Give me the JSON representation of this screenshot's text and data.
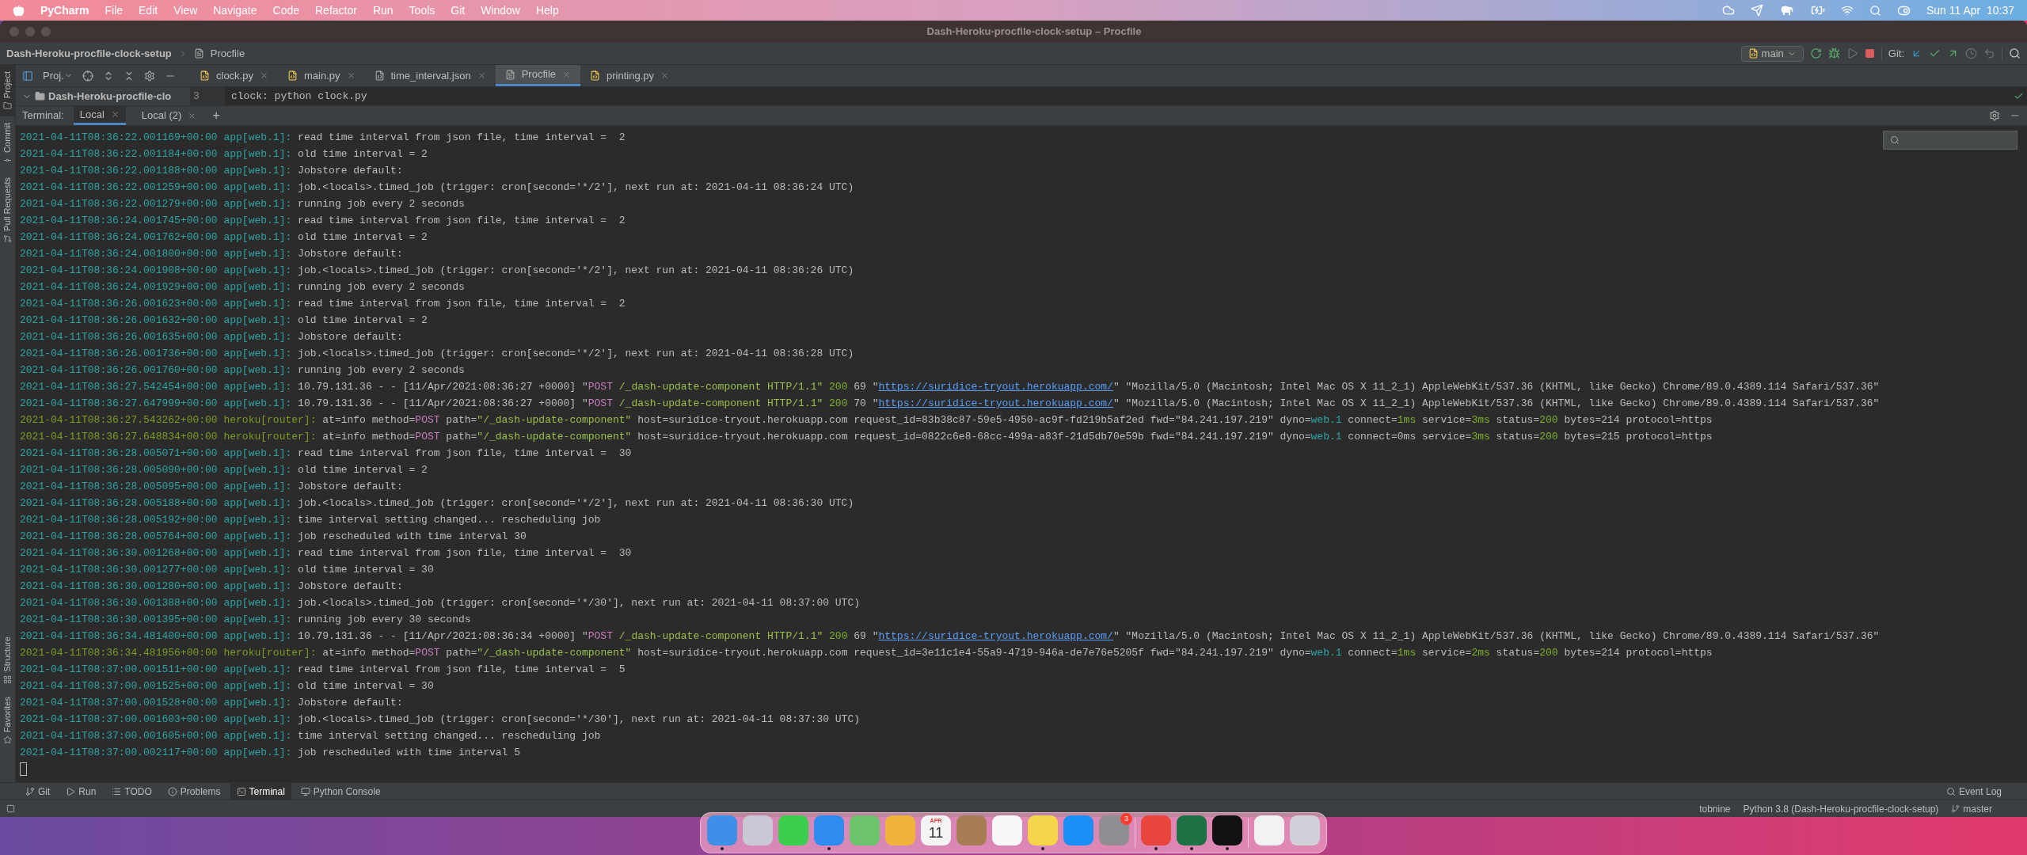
{
  "menu_bar": {
    "items": [
      "PyCharm",
      "File",
      "Edit",
      "View",
      "Navigate",
      "Code",
      "Refactor",
      "Run",
      "Tools",
      "Git",
      "Window",
      "Help"
    ],
    "clock": "Sun 11 Apr  10:37"
  },
  "window": {
    "title": "Dash-Heroku-procfile-clock-setup – Procfile"
  },
  "breadcrumb": [
    "Dash-Heroku-procfile-clock-setup",
    "Procfile"
  ],
  "toolbar": {
    "run_config": "main",
    "git_label": "Git:"
  },
  "project_panel": {
    "label": "Proj.",
    "root": "Dash-Heroku-procfile-clo"
  },
  "editor_tabs": [
    {
      "label": "clock.py",
      "kind": "python",
      "selected": false
    },
    {
      "label": "main.py",
      "kind": "python",
      "selected": false
    },
    {
      "label": "time_interval.json",
      "kind": "json",
      "selected": false
    },
    {
      "label": "Procfile",
      "kind": "text",
      "selected": true
    },
    {
      "label": "printing.py",
      "kind": "python",
      "selected": false
    }
  ],
  "editor": {
    "line_number": "3",
    "code": "clock: python clock.py"
  },
  "side_tabs": {
    "top": [
      {
        "label": "Project",
        "selected": true
      },
      {
        "label": "Commit",
        "selected": false
      },
      {
        "label": "Pull Requests",
        "selected": false
      }
    ],
    "bottom": [
      {
        "label": "Structure",
        "selected": false
      },
      {
        "label": "Favorites",
        "selected": false
      }
    ]
  },
  "terminal": {
    "label": "Terminal:",
    "tabs": [
      {
        "label": "Local",
        "selected": true
      },
      {
        "label": "Local (2)",
        "selected": false
      }
    ],
    "add": "+",
    "lines": [
      {
        "kind": "app",
        "timestamp": "2021-04-11T08:36:22.001169+00:00",
        "source": "app[web.1]:",
        "segments": [
          {
            "kind": "plain",
            "text": "read time interval from json file, time interval =  2"
          }
        ]
      },
      {
        "kind": "app",
        "timestamp": "2021-04-11T08:36:22.001184+00:00",
        "source": "app[web.1]:",
        "segments": [
          {
            "kind": "plain",
            "text": "old time interval = 2"
          }
        ]
      },
      {
        "kind": "app",
        "timestamp": "2021-04-11T08:36:22.001188+00:00",
        "source": "app[web.1]:",
        "segments": [
          {
            "kind": "plain",
            "text": "Jobstore default:"
          }
        ]
      },
      {
        "kind": "app",
        "timestamp": "2021-04-11T08:36:22.001259+00:00",
        "source": "app[web.1]:",
        "segments": [
          {
            "kind": "plain",
            "text": "job.<locals>.timed_job (trigger: cron[second='*/2'], next run at: 2021-04-11 08:36:24 UTC)"
          }
        ]
      },
      {
        "kind": "app",
        "timestamp": "2021-04-11T08:36:22.001279+00:00",
        "source": "app[web.1]:",
        "segments": [
          {
            "kind": "plain",
            "text": "running job every 2 seconds"
          }
        ]
      },
      {
        "kind": "app",
        "timestamp": "2021-04-11T08:36:24.001745+00:00",
        "source": "app[web.1]:",
        "segments": [
          {
            "kind": "plain",
            "text": "read time interval from json file, time interval =  2"
          }
        ]
      },
      {
        "kind": "app",
        "timestamp": "2021-04-11T08:36:24.001762+00:00",
        "source": "app[web.1]:",
        "segments": [
          {
            "kind": "plain",
            "text": "old time interval = 2"
          }
        ]
      },
      {
        "kind": "app",
        "timestamp": "2021-04-11T08:36:24.001800+00:00",
        "source": "app[web.1]:",
        "segments": [
          {
            "kind": "plain",
            "text": "Jobstore default:"
          }
        ]
      },
      {
        "kind": "app",
        "timestamp": "2021-04-11T08:36:24.001908+00:00",
        "source": "app[web.1]:",
        "segments": [
          {
            "kind": "plain",
            "text": "job.<locals>.timed_job (trigger: cron[second='*/2'], next run at: 2021-04-11 08:36:26 UTC)"
          }
        ]
      },
      {
        "kind": "app",
        "timestamp": "2021-04-11T08:36:24.001929+00:00",
        "source": "app[web.1]:",
        "segments": [
          {
            "kind": "plain",
            "text": "running job every 2 seconds"
          }
        ]
      },
      {
        "kind": "app",
        "timestamp": "2021-04-11T08:36:26.001623+00:00",
        "source": "app[web.1]:",
        "segments": [
          {
            "kind": "plain",
            "text": "read time interval from json file, time interval =  2"
          }
        ]
      },
      {
        "kind": "app",
        "timestamp": "2021-04-11T08:36:26.001632+00:00",
        "source": "app[web.1]:",
        "segments": [
          {
            "kind": "plain",
            "text": "old time interval = 2"
          }
        ]
      },
      {
        "kind": "app",
        "timestamp": "2021-04-11T08:36:26.001635+00:00",
        "source": "app[web.1]:",
        "segments": [
          {
            "kind": "plain",
            "text": "Jobstore default:"
          }
        ]
      },
      {
        "kind": "app",
        "timestamp": "2021-04-11T08:36:26.001736+00:00",
        "source": "app[web.1]:",
        "segments": [
          {
            "kind": "plain",
            "text": "job.<locals>.timed_job (trigger: cron[second='*/2'], next run at: 2021-04-11 08:36:28 UTC)"
          }
        ]
      },
      {
        "kind": "app",
        "timestamp": "2021-04-11T08:36:26.001760+00:00",
        "source": "app[web.1]:",
        "segments": [
          {
            "kind": "plain",
            "text": "running job every 2 seconds"
          }
        ]
      },
      {
        "kind": "app",
        "timestamp": "2021-04-11T08:36:27.542454+00:00",
        "source": "app[web.1]:",
        "segments": [
          {
            "kind": "plain",
            "text": "10.79.131.36 - - [11/Apr/2021:08:36:27 +0000] \""
          },
          {
            "kind": "keyword",
            "text": "POST"
          },
          {
            "kind": "string",
            "text": " /_dash-update-component HTTP/1.1\""
          },
          {
            "kind": "number",
            "text": " 200"
          },
          {
            "kind": "plain",
            "text": " 69 \""
          },
          {
            "kind": "link",
            "text": "https://suridice-tryout.herokuapp.com/"
          },
          {
            "kind": "plain",
            "text": "\" \"Mozilla/5.0 (Macintosh; Intel Mac OS X 11_2_1) AppleWebKit/537.36 (KHTML, like Gecko) Chrome/89.0.4389.114 Safari/537.36\""
          }
        ]
      },
      {
        "kind": "app",
        "timestamp": "2021-04-11T08:36:27.647999+00:00",
        "source": "app[web.1]:",
        "segments": [
          {
            "kind": "plain",
            "text": "10.79.131.36 - - [11/Apr/2021:08:36:27 +0000] \""
          },
          {
            "kind": "keyword",
            "text": "POST"
          },
          {
            "kind": "string",
            "text": " /_dash-update-component HTTP/1.1\""
          },
          {
            "kind": "number",
            "text": " 200"
          },
          {
            "kind": "plain",
            "text": " 70 \""
          },
          {
            "kind": "link",
            "text": "https://suridice-tryout.herokuapp.com/"
          },
          {
            "kind": "plain",
            "text": "\" \"Mozilla/5.0 (Macintosh; Intel Mac OS X 11_2_1) AppleWebKit/537.36 (KHTML, like Gecko) Chrome/89.0.4389.114 Safari/537.36\""
          }
        ]
      },
      {
        "kind": "router",
        "timestamp": "2021-04-11T08:36:27.543262+00:00",
        "source": "heroku[router]:",
        "segments": [
          {
            "kind": "plain",
            "text": "at=info method="
          },
          {
            "kind": "keyword",
            "text": "POST"
          },
          {
            "kind": "plain",
            "text": " path="
          },
          {
            "kind": "string",
            "text": "\"/_dash-update-component\""
          },
          {
            "kind": "plain",
            "text": " host=suridice-tryout.herokuapp.com request_id=83b38c87-59e5-4950-ac9f-fd219b5af2ed fwd=\"84.241.197.219\" dyno="
          },
          {
            "kind": "value",
            "text": "web.1"
          },
          {
            "kind": "plain",
            "text": " connect="
          },
          {
            "kind": "number",
            "text": "1ms"
          },
          {
            "kind": "plain",
            "text": " service="
          },
          {
            "kind": "number",
            "text": "3ms"
          },
          {
            "kind": "plain",
            "text": " status="
          },
          {
            "kind": "number",
            "text": "200"
          },
          {
            "kind": "plain",
            "text": " bytes=214 protocol=https"
          }
        ]
      },
      {
        "kind": "router",
        "timestamp": "2021-04-11T08:36:27.648834+00:00",
        "source": "heroku[router]:",
        "segments": [
          {
            "kind": "plain",
            "text": "at=info method="
          },
          {
            "kind": "keyword",
            "text": "POST"
          },
          {
            "kind": "plain",
            "text": " path="
          },
          {
            "kind": "string",
            "text": "\"/_dash-update-component\""
          },
          {
            "kind": "plain",
            "text": " host=suridice-tryout.herokuapp.com request_id=0822c6e8-68cc-499a-a83f-21d5db70e59b fwd=\"84.241.197.219\" dyno="
          },
          {
            "kind": "value",
            "text": "web.1"
          },
          {
            "kind": "plain",
            "text": " connect=0ms service="
          },
          {
            "kind": "number",
            "text": "3ms"
          },
          {
            "kind": "plain",
            "text": " status="
          },
          {
            "kind": "number",
            "text": "200"
          },
          {
            "kind": "plain",
            "text": " bytes=215 protocol=https"
          }
        ]
      },
      {
        "kind": "app",
        "timestamp": "2021-04-11T08:36:28.005071+00:00",
        "source": "app[web.1]:",
        "segments": [
          {
            "kind": "plain",
            "text": "read time interval from json file, time interval =  30"
          }
        ]
      },
      {
        "kind": "app",
        "timestamp": "2021-04-11T08:36:28.005090+00:00",
        "source": "app[web.1]:",
        "segments": [
          {
            "kind": "plain",
            "text": "old time interval = 2"
          }
        ]
      },
      {
        "kind": "app",
        "timestamp": "2021-04-11T08:36:28.005095+00:00",
        "source": "app[web.1]:",
        "segments": [
          {
            "kind": "plain",
            "text": "Jobstore default:"
          }
        ]
      },
      {
        "kind": "app",
        "timestamp": "2021-04-11T08:36:28.005188+00:00",
        "source": "app[web.1]:",
        "segments": [
          {
            "kind": "plain",
            "text": "job.<locals>.timed_job (trigger: cron[second='*/2'], next run at: 2021-04-11 08:36:30 UTC)"
          }
        ]
      },
      {
        "kind": "app",
        "timestamp": "2021-04-11T08:36:28.005192+00:00",
        "source": "app[web.1]:",
        "segments": [
          {
            "kind": "plain",
            "text": "time interval setting changed... rescheduling job"
          }
        ]
      },
      {
        "kind": "app",
        "timestamp": "2021-04-11T08:36:28.005764+00:00",
        "source": "app[web.1]:",
        "segments": [
          {
            "kind": "plain",
            "text": "job rescheduled with time interval 30"
          }
        ]
      },
      {
        "kind": "app",
        "timestamp": "2021-04-11T08:36:30.001268+00:00",
        "source": "app[web.1]:",
        "segments": [
          {
            "kind": "plain",
            "text": "read time interval from json file, time interval =  30"
          }
        ]
      },
      {
        "kind": "app",
        "timestamp": "2021-04-11T08:36:30.001277+00:00",
        "source": "app[web.1]:",
        "segments": [
          {
            "kind": "plain",
            "text": "old time interval = 30"
          }
        ]
      },
      {
        "kind": "app",
        "timestamp": "2021-04-11T08:36:30.001280+00:00",
        "source": "app[web.1]:",
        "segments": [
          {
            "kind": "plain",
            "text": "Jobstore default:"
          }
        ]
      },
      {
        "kind": "app",
        "timestamp": "2021-04-11T08:36:30.001388+00:00",
        "source": "app[web.1]:",
        "segments": [
          {
            "kind": "plain",
            "text": "job.<locals>.timed_job (trigger: cron[second='*/30'], next run at: 2021-04-11 08:37:00 UTC)"
          }
        ]
      },
      {
        "kind": "app",
        "timestamp": "2021-04-11T08:36:30.001395+00:00",
        "source": "app[web.1]:",
        "segments": [
          {
            "kind": "plain",
            "text": "running job every 30 seconds"
          }
        ]
      },
      {
        "kind": "app",
        "timestamp": "2021-04-11T08:36:34.481400+00:00",
        "source": "app[web.1]:",
        "segments": [
          {
            "kind": "plain",
            "text": "10.79.131.36 - - [11/Apr/2021:08:36:34 +0000] \""
          },
          {
            "kind": "keyword",
            "text": "POST"
          },
          {
            "kind": "string",
            "text": " /_dash-update-component HTTP/1.1\""
          },
          {
            "kind": "number",
            "text": " 200"
          },
          {
            "kind": "plain",
            "text": " 69 \""
          },
          {
            "kind": "link",
            "text": "https://suridice-tryout.herokuapp.com/"
          },
          {
            "kind": "plain",
            "text": "\" \"Mozilla/5.0 (Macintosh; Intel Mac OS X 11_2_1) AppleWebKit/537.36 (KHTML, like Gecko) Chrome/89.0.4389.114 Safari/537.36\""
          }
        ]
      },
      {
        "kind": "router",
        "timestamp": "2021-04-11T08:36:34.481956+00:00",
        "source": "heroku[router]:",
        "segments": [
          {
            "kind": "plain",
            "text": "at=info method="
          },
          {
            "kind": "keyword",
            "text": "POST"
          },
          {
            "kind": "plain",
            "text": " path="
          },
          {
            "kind": "string",
            "text": "\"/_dash-update-component\""
          },
          {
            "kind": "plain",
            "text": " host=suridice-tryout.herokuapp.com request_id=3e11c1e4-55a9-4719-946a-de7e76e5205f fwd=\"84.241.197.219\" dyno="
          },
          {
            "kind": "value",
            "text": "web.1"
          },
          {
            "kind": "plain",
            "text": " connect="
          },
          {
            "kind": "number",
            "text": "1ms"
          },
          {
            "kind": "plain",
            "text": " service="
          },
          {
            "kind": "number",
            "text": "2ms"
          },
          {
            "kind": "plain",
            "text": " status="
          },
          {
            "kind": "number",
            "text": "200"
          },
          {
            "kind": "plain",
            "text": " bytes=214 protocol=https"
          }
        ]
      },
      {
        "kind": "app",
        "timestamp": "2021-04-11T08:37:00.001511+00:00",
        "source": "app[web.1]:",
        "segments": [
          {
            "kind": "plain",
            "text": "read time interval from json file, time interval =  5"
          }
        ]
      },
      {
        "kind": "app",
        "timestamp": "2021-04-11T08:37:00.001525+00:00",
        "source": "app[web.1]:",
        "segments": [
          {
            "kind": "plain",
            "text": "old time interval = 30"
          }
        ]
      },
      {
        "kind": "app",
        "timestamp": "2021-04-11T08:37:00.001528+00:00",
        "source": "app[web.1]:",
        "segments": [
          {
            "kind": "plain",
            "text": "Jobstore default:"
          }
        ]
      },
      {
        "kind": "app",
        "timestamp": "2021-04-11T08:37:00.001603+00:00",
        "source": "app[web.1]:",
        "segments": [
          {
            "kind": "plain",
            "text": "job.<locals>.timed_job (trigger: cron[second='*/30'], next run at: 2021-04-11 08:37:30 UTC)"
          }
        ]
      },
      {
        "kind": "app",
        "timestamp": "2021-04-11T08:37:00.001605+00:00",
        "source": "app[web.1]:",
        "segments": [
          {
            "kind": "plain",
            "text": "time interval setting changed... rescheduling job"
          }
        ]
      },
      {
        "kind": "app",
        "timestamp": "2021-04-11T08:37:00.002117+00:00",
        "source": "app[web.1]:",
        "segments": [
          {
            "kind": "plain",
            "text": "job rescheduled with time interval 5"
          }
        ]
      }
    ]
  },
  "tool_tabs": [
    {
      "label": "Git",
      "kind": "git",
      "selected": false
    },
    {
      "label": "Run",
      "kind": "run",
      "selected": false
    },
    {
      "label": "TODO",
      "kind": "todo",
      "selected": false
    },
    {
      "label": "Problems",
      "kind": "problems",
      "selected": false
    },
    {
      "label": "Terminal",
      "kind": "terminal",
      "selected": true
    },
    {
      "label": "Python Console",
      "kind": "console",
      "selected": false
    }
  ],
  "event_log": "Event Log",
  "status_bar": {
    "plugin": "tobnine",
    "interpreter": "Python 3.8 (Dash-Heroku-procfile-clock-setup)",
    "branch": "master"
  },
  "dock": [
    {
      "kind": "app",
      "color": "#3d8fe8",
      "running": true
    },
    {
      "kind": "app",
      "color": "#c9c9d6",
      "running": false
    },
    {
      "kind": "app",
      "color": "#3ccf4e",
      "running": false
    },
    {
      "kind": "app",
      "color": "#2e8cf0",
      "running": true
    },
    {
      "kind": "app",
      "color": "#6bc46b",
      "running": false
    },
    {
      "kind": "app",
      "color": "#f2b33c",
      "running": false
    },
    {
      "kind": "calendar",
      "color": "#f4f4f4",
      "running": false,
      "month": "APR",
      "day": "11"
    },
    {
      "kind": "app",
      "color": "#a67c52",
      "running": false
    },
    {
      "kind": "app",
      "color": "#f8f8f8",
      "running": false
    },
    {
      "kind": "app",
      "color": "#f7d54a",
      "running": true
    },
    {
      "kind": "app",
      "color": "#1a8ff5",
      "running": false
    },
    {
      "kind": "app",
      "color": "#8e8e93",
      "running": false,
      "badge": "3"
    },
    {
      "kind": "separator"
    },
    {
      "kind": "app",
      "color": "#e8453c",
      "running": true
    },
    {
      "kind": "app",
      "color": "#1e7145",
      "running": true
    },
    {
      "kind": "app",
      "color": "#111111",
      "running": true
    },
    {
      "kind": "separator"
    },
    {
      "kind": "app",
      "color": "#f2f2f2",
      "running": false
    },
    {
      "kind": "app",
      "color": "#d0d0d8",
      "running": false
    }
  ]
}
